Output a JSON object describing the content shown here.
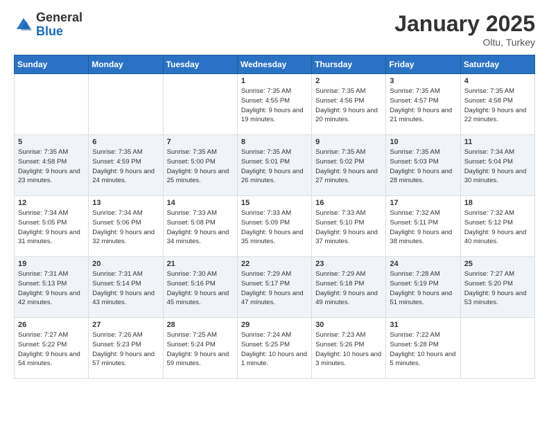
{
  "header": {
    "logo_general": "General",
    "logo_blue": "Blue",
    "month": "January 2025",
    "location": "Oltu, Turkey"
  },
  "weekdays": [
    "Sunday",
    "Monday",
    "Tuesday",
    "Wednesday",
    "Thursday",
    "Friday",
    "Saturday"
  ],
  "weeks": [
    [
      null,
      null,
      null,
      {
        "day": "1",
        "sunrise": "7:35 AM",
        "sunset": "4:55 PM",
        "daylight": "9 hours and 19 minutes."
      },
      {
        "day": "2",
        "sunrise": "7:35 AM",
        "sunset": "4:56 PM",
        "daylight": "9 hours and 20 minutes."
      },
      {
        "day": "3",
        "sunrise": "7:35 AM",
        "sunset": "4:57 PM",
        "daylight": "9 hours and 21 minutes."
      },
      {
        "day": "4",
        "sunrise": "7:35 AM",
        "sunset": "4:58 PM",
        "daylight": "9 hours and 22 minutes."
      }
    ],
    [
      {
        "day": "5",
        "sunrise": "7:35 AM",
        "sunset": "4:58 PM",
        "daylight": "9 hours and 23 minutes."
      },
      {
        "day": "6",
        "sunrise": "7:35 AM",
        "sunset": "4:59 PM",
        "daylight": "9 hours and 24 minutes."
      },
      {
        "day": "7",
        "sunrise": "7:35 AM",
        "sunset": "5:00 PM",
        "daylight": "9 hours and 25 minutes."
      },
      {
        "day": "8",
        "sunrise": "7:35 AM",
        "sunset": "5:01 PM",
        "daylight": "9 hours and 26 minutes."
      },
      {
        "day": "9",
        "sunrise": "7:35 AM",
        "sunset": "5:02 PM",
        "daylight": "9 hours and 27 minutes."
      },
      {
        "day": "10",
        "sunrise": "7:35 AM",
        "sunset": "5:03 PM",
        "daylight": "9 hours and 28 minutes."
      },
      {
        "day": "11",
        "sunrise": "7:34 AM",
        "sunset": "5:04 PM",
        "daylight": "9 hours and 30 minutes."
      }
    ],
    [
      {
        "day": "12",
        "sunrise": "7:34 AM",
        "sunset": "5:05 PM",
        "daylight": "9 hours and 31 minutes."
      },
      {
        "day": "13",
        "sunrise": "7:34 AM",
        "sunset": "5:06 PM",
        "daylight": "9 hours and 32 minutes."
      },
      {
        "day": "14",
        "sunrise": "7:33 AM",
        "sunset": "5:08 PM",
        "daylight": "9 hours and 34 minutes."
      },
      {
        "day": "15",
        "sunrise": "7:33 AM",
        "sunset": "5:09 PM",
        "daylight": "9 hours and 35 minutes."
      },
      {
        "day": "16",
        "sunrise": "7:33 AM",
        "sunset": "5:10 PM",
        "daylight": "9 hours and 37 minutes."
      },
      {
        "day": "17",
        "sunrise": "7:32 AM",
        "sunset": "5:11 PM",
        "daylight": "9 hours and 38 minutes."
      },
      {
        "day": "18",
        "sunrise": "7:32 AM",
        "sunset": "5:12 PM",
        "daylight": "9 hours and 40 minutes."
      }
    ],
    [
      {
        "day": "19",
        "sunrise": "7:31 AM",
        "sunset": "5:13 PM",
        "daylight": "9 hours and 42 minutes."
      },
      {
        "day": "20",
        "sunrise": "7:31 AM",
        "sunset": "5:14 PM",
        "daylight": "9 hours and 43 minutes."
      },
      {
        "day": "21",
        "sunrise": "7:30 AM",
        "sunset": "5:16 PM",
        "daylight": "9 hours and 45 minutes."
      },
      {
        "day": "22",
        "sunrise": "7:29 AM",
        "sunset": "5:17 PM",
        "daylight": "9 hours and 47 minutes."
      },
      {
        "day": "23",
        "sunrise": "7:29 AM",
        "sunset": "5:18 PM",
        "daylight": "9 hours and 49 minutes."
      },
      {
        "day": "24",
        "sunrise": "7:28 AM",
        "sunset": "5:19 PM",
        "daylight": "9 hours and 51 minutes."
      },
      {
        "day": "25",
        "sunrise": "7:27 AM",
        "sunset": "5:20 PM",
        "daylight": "9 hours and 53 minutes."
      }
    ],
    [
      {
        "day": "26",
        "sunrise": "7:27 AM",
        "sunset": "5:22 PM",
        "daylight": "9 hours and 54 minutes."
      },
      {
        "day": "27",
        "sunrise": "7:26 AM",
        "sunset": "5:23 PM",
        "daylight": "9 hours and 57 minutes."
      },
      {
        "day": "28",
        "sunrise": "7:25 AM",
        "sunset": "5:24 PM",
        "daylight": "9 hours and 59 minutes."
      },
      {
        "day": "29",
        "sunrise": "7:24 AM",
        "sunset": "5:25 PM",
        "daylight": "10 hours and 1 minute."
      },
      {
        "day": "30",
        "sunrise": "7:23 AM",
        "sunset": "5:26 PM",
        "daylight": "10 hours and 3 minutes."
      },
      {
        "day": "31",
        "sunrise": "7:22 AM",
        "sunset": "5:28 PM",
        "daylight": "10 hours and 5 minutes."
      },
      null
    ]
  ],
  "labels": {
    "sunrise": "Sunrise:",
    "sunset": "Sunset:",
    "daylight": "Daylight:"
  }
}
